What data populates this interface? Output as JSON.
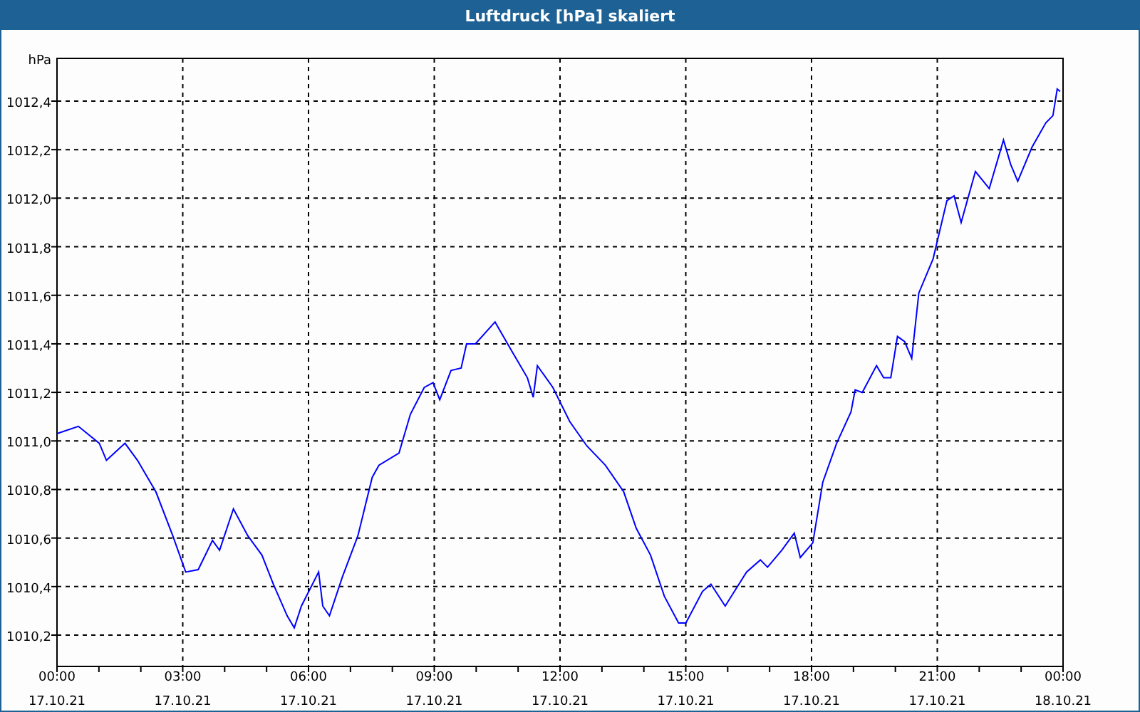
{
  "window": {
    "title": "Luftdruck [hPa] skaliert"
  },
  "chart": {
    "chart_data": {
      "type": "line",
      "ylabel": "hPa",
      "x": [
        0,
        0.51,
        1.01,
        1.18,
        1.62,
        1.92,
        2.36,
        2.76,
        3.07,
        3.37,
        3.71,
        3.88,
        4.21,
        4.55,
        4.89,
        5.16,
        5.49,
        5.66,
        5.83,
        6.24,
        6.34,
        6.5,
        6.81,
        7.18,
        7.52,
        7.68,
        8.16,
        8.43,
        8.76,
        8.97,
        9.13,
        9.4,
        9.64,
        9.77,
        9.98,
        10.45,
        10.85,
        11.22,
        11.36,
        11.46,
        11.83,
        12.23,
        12.64,
        13.08,
        13.52,
        13.82,
        14.16,
        14.49,
        14.83,
        15,
        15.4,
        15.6,
        15.94,
        16.45,
        16.78,
        16.95,
        17.29,
        17.59,
        17.73,
        18.03,
        18.27,
        18.6,
        18.94,
        19.04,
        19.21,
        19.55,
        19.72,
        19.89,
        20.05,
        20.22,
        20.39,
        20.56,
        20.9,
        21.23,
        21.4,
        21.57,
        21.91,
        22.24,
        22.58,
        22.75,
        22.92,
        23.26,
        23.59,
        23.76,
        23.86,
        23.93
      ],
      "series": [
        {
          "color": "#0000ff",
          "values": [
            1011.03,
            1011.06,
            1010.99,
            1010.92,
            1010.99,
            1010.92,
            1010.79,
            1010.61,
            1010.46,
            1010.47,
            1010.59,
            1010.55,
            1010.72,
            1010.61,
            1010.53,
            1010.41,
            1010.28,
            1010.23,
            1010.32,
            1010.46,
            1010.32,
            1010.28,
            1010.44,
            1010.61,
            1010.85,
            1010.9,
            1010.95,
            1011.11,
            1011.22,
            1011.24,
            1011.17,
            1011.29,
            1011.3,
            1011.4,
            1011.4,
            1011.49,
            1011.37,
            1011.26,
            1011.18,
            1011.31,
            1011.22,
            1011.08,
            1010.98,
            1010.9,
            1010.79,
            1010.64,
            1010.53,
            1010.36,
            1010.25,
            1010.25,
            1010.38,
            1010.41,
            1010.32,
            1010.46,
            1010.51,
            1010.48,
            1010.55,
            1010.62,
            1010.52,
            1010.58,
            1010.83,
            1010.99,
            1011.12,
            1011.21,
            1011.2,
            1011.31,
            1011.26,
            1011.26,
            1011.43,
            1011.41,
            1011.34,
            1011.61,
            1011.75,
            1011.99,
            1012.01,
            1011.9,
            1012.11,
            1012.04,
            1012.24,
            1012.14,
            1012.07,
            1012.21,
            1012.31,
            1012.34,
            1012.45,
            1012.44
          ]
        }
      ],
      "grid": true,
      "xlim": [
        0,
        24
      ],
      "ylim": [
        1010.071,
        1012.576
      ],
      "xticks": [
        {
          "value": 0,
          "label": "00:00"
        },
        {
          "value": 3,
          "label": "03:00"
        },
        {
          "value": 6,
          "label": "06:00"
        },
        {
          "value": 9,
          "label": "09:00"
        },
        {
          "value": 12,
          "label": "12:00"
        },
        {
          "value": 15,
          "label": "15:00"
        },
        {
          "value": 18,
          "label": "18:00"
        },
        {
          "value": 21,
          "label": "21:00"
        },
        {
          "value": 24,
          "label": "00:00"
        }
      ],
      "yticks": [
        {
          "value": 1010.2,
          "label": "1010,2"
        },
        {
          "value": 1010.4,
          "label": "1010,4"
        },
        {
          "value": 1010.6,
          "label": "1010,6"
        },
        {
          "value": 1010.8,
          "label": "1010,8"
        },
        {
          "value": 1011.0,
          "label": "1011,0"
        },
        {
          "value": 1011.2,
          "label": "1011,2"
        },
        {
          "value": 1011.4,
          "label": "1011,4"
        },
        {
          "value": 1011.6,
          "label": "1011,6"
        },
        {
          "value": 1011.8,
          "label": "1011,8"
        },
        {
          "value": 1012.0,
          "label": "1012,0"
        },
        {
          "value": 1012.2,
          "label": "1012,2"
        },
        {
          "value": 1012.4,
          "label": "1012,4"
        }
      ]
    },
    "x_date_labels": [
      "17.10.21",
      "17.10.21",
      "17.10.21",
      "17.10.21",
      "17.10.21",
      "17.10.21",
      "17.10.21",
      "17.10.21",
      "18.10.21"
    ]
  }
}
